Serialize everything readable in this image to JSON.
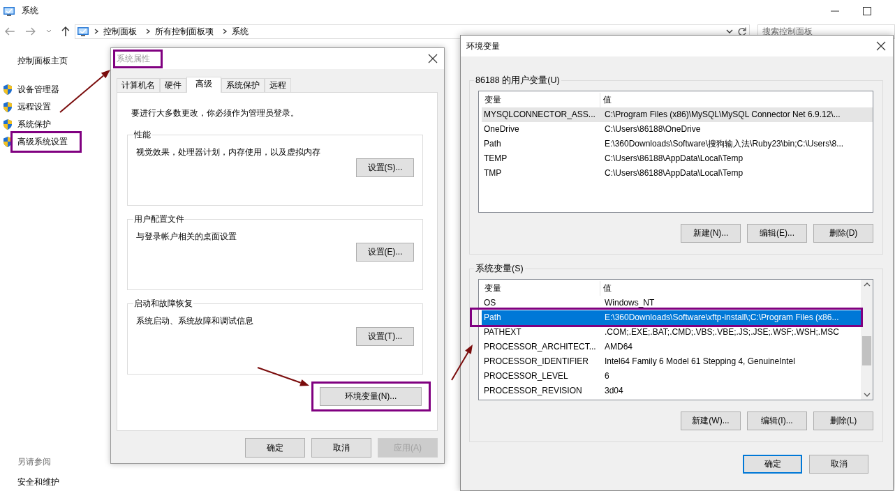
{
  "main_window": {
    "title": "系统",
    "address": [
      "控制面板",
      "所有控制面板项",
      "系统"
    ],
    "search": {
      "placeholder": "搜索控制面板"
    },
    "sidebar": {
      "home": "控制面板主页",
      "items": [
        {
          "label": "设备管理器",
          "highlighted": false
        },
        {
          "label": "远程设置",
          "highlighted": false
        },
        {
          "label": "系统保护",
          "highlighted": false
        },
        {
          "label": "高级系统设置",
          "highlighted": true
        }
      ],
      "see_also": {
        "heading": "另请参阅",
        "items": [
          "安全和维护"
        ]
      }
    }
  },
  "system_properties": {
    "title": "系统属性",
    "active": false,
    "highlighted": true,
    "tabs": [
      {
        "label": "计算机名",
        "selected": false
      },
      {
        "label": "硬件",
        "selected": false
      },
      {
        "label": "高级",
        "selected": true
      },
      {
        "label": "系统保护",
        "selected": false
      },
      {
        "label": "远程",
        "selected": false
      }
    ],
    "note": "要进行大多数更改，你必须作为管理员登录。",
    "groups": [
      {
        "title": "性能",
        "description": "视觉效果，处理器计划，内存使用，以及虚拟内存",
        "button": "设置(S)..."
      },
      {
        "title": "用户配置文件",
        "description": "与登录帐户相关的桌面设置",
        "button": "设置(E)..."
      },
      {
        "title": "启动和故障恢复",
        "description": "系统启动、系统故障和调试信息",
        "button": "设置(T)..."
      }
    ],
    "env_button": {
      "label": "环境变量(N)...",
      "highlighted": true
    },
    "buttons": [
      {
        "label": "确定",
        "disabled": false
      },
      {
        "label": "取消",
        "disabled": false
      },
      {
        "label": "应用(A)",
        "disabled": true
      }
    ]
  },
  "environment_variables": {
    "title": "环境变量",
    "active": true,
    "user_variables": {
      "title": "86188 的用户变量(U)",
      "focused": false,
      "scrollable": false,
      "columns": [
        "变量",
        "值"
      ],
      "rows": [
        {
          "name": "MYSQLCONNECTOR_ASS...",
          "value": "C:\\Program Files (x86)\\MySQL\\MySQL Connector Net 6.9.12\\...",
          "selected": true,
          "highlighted": false
        },
        {
          "name": "OneDrive",
          "value": "C:\\Users\\86188\\OneDrive",
          "selected": false,
          "highlighted": false
        },
        {
          "name": "Path",
          "value": "E:\\360Downloads\\Software\\搜狗输入法\\Ruby23\\bin;C:\\Users\\8...",
          "selected": false,
          "highlighted": false
        },
        {
          "name": "TEMP",
          "value": "C:\\Users\\86188\\AppData\\Local\\Temp",
          "selected": false,
          "highlighted": false
        },
        {
          "name": "TMP",
          "value": "C:\\Users\\86188\\AppData\\Local\\Temp",
          "selected": false,
          "highlighted": false
        }
      ],
      "buttons": [
        "新建(N)...",
        "编辑(E)...",
        "删除(D)"
      ]
    },
    "system_variables": {
      "title": "系统变量(S)",
      "focused": true,
      "scrollable": true,
      "columns": [
        "变量",
        "值"
      ],
      "rows": [
        {
          "name": "OS",
          "value": "Windows_NT",
          "selected": false,
          "highlighted": false
        },
        {
          "name": "Path",
          "value": "E:\\360Downloads\\Software\\xftp-install\\;C:\\Program Files (x86...",
          "selected": true,
          "highlighted": true
        },
        {
          "name": "PATHEXT",
          "value": ".COM;.EXE;.BAT;.CMD;.VBS;.VBE;.JS;.JSE;.WSF;.WSH;.MSC",
          "selected": false,
          "highlighted": false
        },
        {
          "name": "PROCESSOR_ARCHITECT...",
          "value": "AMD64",
          "selected": false,
          "highlighted": false
        },
        {
          "name": "PROCESSOR_IDENTIFIER",
          "value": "Intel64 Family 6 Model 61 Stepping 4, GenuineIntel",
          "selected": false,
          "highlighted": false
        },
        {
          "name": "PROCESSOR_LEVEL",
          "value": "6",
          "selected": false,
          "highlighted": false
        },
        {
          "name": "PROCESSOR_REVISION",
          "value": "3d04",
          "selected": false,
          "highlighted": false
        }
      ],
      "buttons": [
        "新建(W)...",
        "编辑(I)...",
        "删除(L)"
      ]
    },
    "buttons": [
      {
        "label": "确定",
        "default": true
      },
      {
        "label": "取消",
        "default": false
      }
    ]
  }
}
